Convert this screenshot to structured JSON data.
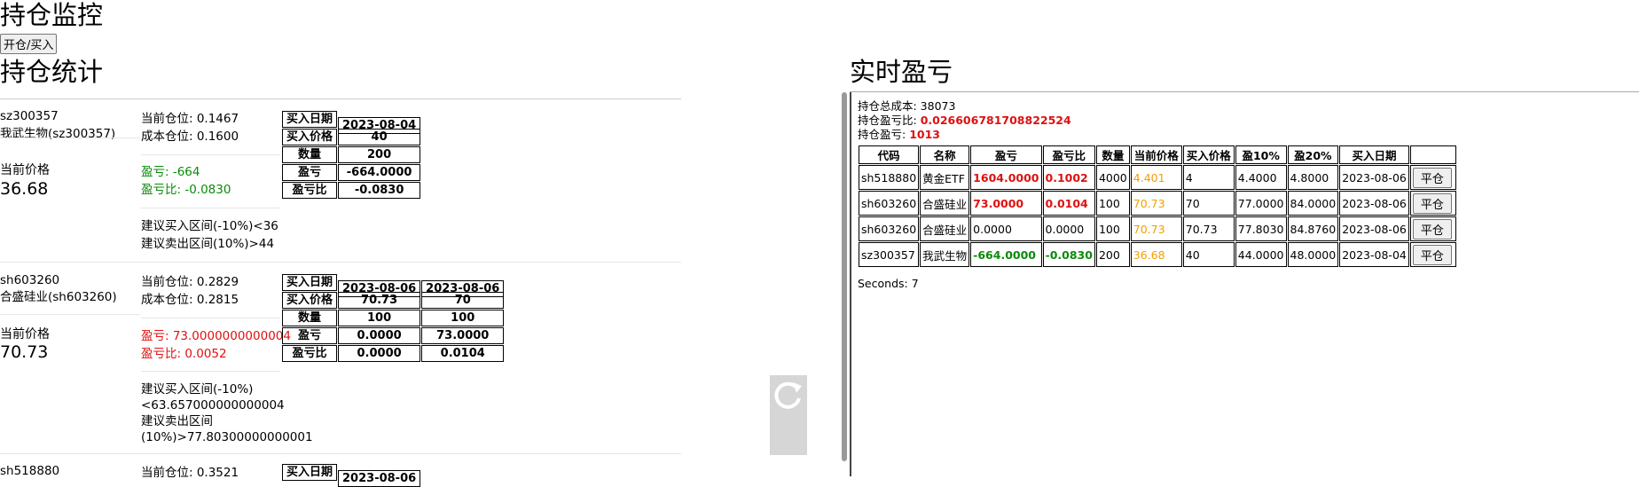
{
  "page": {
    "title": "持仓监控",
    "open_button": "开仓/买入"
  },
  "left": {
    "section_title": "持仓统计",
    "price_label": "当前价格",
    "cards": [
      {
        "code": "sz300357",
        "name": "我武生物(sz300357)",
        "price": "36.68",
        "cur_pos": "当前仓位: 0.1467",
        "cost_pos": "成本仓位: 0.1600",
        "pnl": "盈亏: -664",
        "pnl_ratio": "盈亏比: -0.0830",
        "advice": [
          "建议买入区间(-10%)<36",
          "建议卖出区间(10%)>44"
        ],
        "table": [
          [
            "买入日期",
            "2023-08-04"
          ],
          [
            "买入价格",
            "40"
          ],
          [
            "数量",
            "200"
          ],
          [
            "盈亏",
            "-664.0000"
          ],
          [
            "盈亏比",
            "-0.0830"
          ]
        ]
      },
      {
        "code": "sh603260",
        "name": "合盛硅业(sh603260)",
        "price": "70.73",
        "cur_pos": "当前仓位: 0.2829",
        "cost_pos": "成本仓位: 0.2815",
        "pnl": "盈亏: 73.0000000000004",
        "pnl_ratio": "盈亏比: 0.0052",
        "advice": [
          "建议买入区间(-10%)",
          "<63.657000000000004",
          "建议卖出区间",
          "(10%)>77.80300000000001"
        ],
        "table": [
          [
            "买入日期",
            "2023-08-06",
            "2023-08-06"
          ],
          [
            "买入价格",
            "70.73",
            "70"
          ],
          [
            "数量",
            "100",
            "100"
          ],
          [
            "盈亏",
            "0.0000",
            "73.0000"
          ],
          [
            "盈亏比",
            "0.0000",
            "0.0104"
          ]
        ]
      },
      {
        "code": "sh518880",
        "cur_pos": "当前仓位: 0.3521",
        "table_header": "买入日期",
        "table_date": "2023-08-06"
      }
    ]
  },
  "right": {
    "section_title": "实时盈亏",
    "total_cost": "持仓总成本: 38073",
    "ratio_label": "持仓盈亏比: ",
    "ratio_value": "0.026606781708822524",
    "pnl_label": "持仓盈亏: ",
    "pnl_value": "1013",
    "headers": [
      "代码",
      "名称",
      "盈亏",
      "盈亏比",
      "数量",
      "当前价格",
      "买入价格",
      "盈10%",
      "盈20%",
      "买入日期",
      ""
    ],
    "rows": [
      [
        "sh518880",
        "黄金ETF",
        "1604.0000",
        "0.1002",
        "4000",
        "4.401",
        "4",
        "4.4000",
        "4.8000",
        "2023-08-06",
        "平仓"
      ],
      [
        "sh603260",
        "合盛硅业",
        "73.0000",
        "0.0104",
        "100",
        "70.73",
        "70",
        "77.0000",
        "84.0000",
        "2023-08-06",
        "平仓"
      ],
      [
        "sh603260",
        "合盛硅业",
        "0.0000",
        "0.0000",
        "100",
        "70.73",
        "70.73",
        "77.8030",
        "84.8760",
        "2023-08-06",
        "平仓"
      ],
      [
        "sz300357",
        "我武生物",
        "-664.0000",
        "-0.0830",
        "200",
        "36.68",
        "40",
        "44.0000",
        "48.0000",
        "2023-08-04",
        "平仓"
      ]
    ],
    "seconds": "Seconds: 7"
  }
}
